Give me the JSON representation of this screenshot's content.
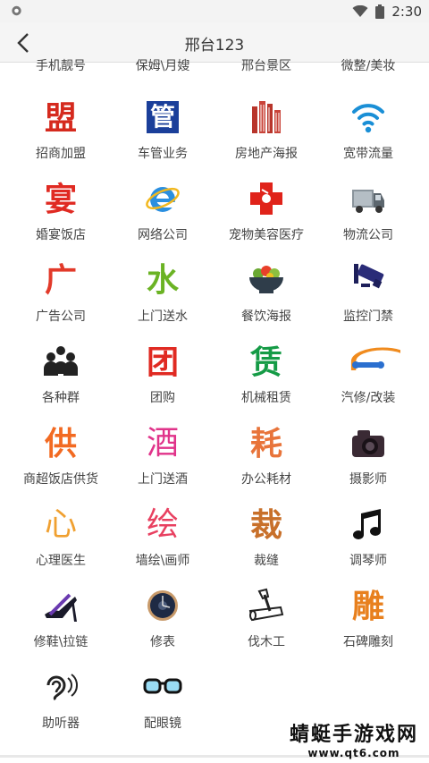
{
  "status": {
    "time": "2:30"
  },
  "header": {
    "title": "邢台123"
  },
  "top_row": [
    "手机靓号",
    "保姆\\月嫂",
    "邢台景区",
    "微整/美妆"
  ],
  "grid": [
    {
      "label": "招商加盟",
      "icon": "league-icon",
      "glyph": "盟",
      "color": "#d52a1e"
    },
    {
      "label": "车管业务",
      "icon": "vehicle-admin-icon",
      "glyph": "管",
      "color": "#ffffff"
    },
    {
      "label": "房地产海报",
      "icon": "building-icon"
    },
    {
      "label": "宽带流量",
      "icon": "wifi-icon"
    },
    {
      "label": "婚宴饭店",
      "icon": "banquet-icon",
      "glyph": "宴",
      "color": "#e02a22"
    },
    {
      "label": "网络公司",
      "icon": "ie-browser-icon"
    },
    {
      "label": "宠物美容医疗",
      "icon": "pet-medical-cross-icon"
    },
    {
      "label": "物流公司",
      "icon": "truck-icon"
    },
    {
      "label": "广告公司",
      "icon": "ad-icon",
      "glyph": "广",
      "color": "#e23a2a"
    },
    {
      "label": "上门送水",
      "icon": "water-icon",
      "glyph": "水",
      "color": "#6bb324"
    },
    {
      "label": "餐饮海报",
      "icon": "salad-bowl-icon"
    },
    {
      "label": "监控门禁",
      "icon": "cctv-camera-icon"
    },
    {
      "label": "各种群",
      "icon": "group-people-icon"
    },
    {
      "label": "团购",
      "icon": "group-buy-icon",
      "glyph": "团",
      "color": "#e02a22"
    },
    {
      "label": "机械租赁",
      "icon": "lease-icon",
      "glyph": "赁",
      "color": "#159b46"
    },
    {
      "label": "汽修/改装",
      "icon": "car-wrench-icon"
    },
    {
      "label": "商超饭店供货",
      "icon": "supply-icon",
      "glyph": "供",
      "color": "#f26a22"
    },
    {
      "label": "上门送酒",
      "icon": "liquor-icon",
      "glyph": "酒",
      "color": "#e0338a"
    },
    {
      "label": "办公耗材",
      "icon": "consumables-icon",
      "glyph": "耗",
      "color": "#e8743a"
    },
    {
      "label": "摄影师",
      "icon": "camera-icon"
    },
    {
      "label": "心理医生",
      "icon": "heart-icon",
      "glyph": "心",
      "color": "#f0a030"
    },
    {
      "label": "墙绘\\画师",
      "icon": "paint-icon",
      "glyph": "绘",
      "color": "#e84060"
    },
    {
      "label": "裁缝",
      "icon": "tailor-icon",
      "glyph": "裁",
      "color": "#c8702a"
    },
    {
      "label": "调琴师",
      "icon": "music-note-icon"
    },
    {
      "label": "修鞋\\拉链",
      "icon": "high-heel-icon"
    },
    {
      "label": "修表",
      "icon": "watch-icon"
    },
    {
      "label": "伐木工",
      "icon": "axe-log-icon"
    },
    {
      "label": "石碑雕刻",
      "icon": "carve-icon",
      "glyph": "雕",
      "color": "#e8801e"
    },
    {
      "label": "助听器",
      "icon": "ear-icon"
    },
    {
      "label": "配眼镜",
      "icon": "glasses-icon"
    }
  ],
  "watermark": {
    "text": "蜻蜓手游戏网",
    "url": "www.qt6.com"
  }
}
